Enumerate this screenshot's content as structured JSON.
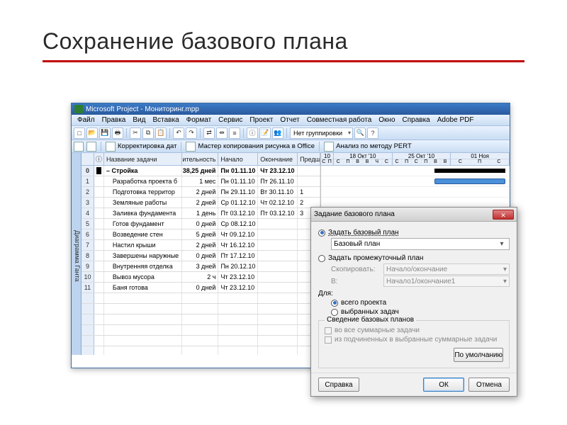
{
  "slide": {
    "title": "Сохранение базового плана"
  },
  "app": {
    "title": "Microsoft Project - Мониторинг.mpp",
    "menus": [
      "Файл",
      "Правка",
      "Вид",
      "Вставка",
      "Формат",
      "Сервис",
      "Проект",
      "Отчет",
      "Совместная работа",
      "Окно",
      "Справка",
      "Adobe PDF"
    ],
    "grouping": "Нет группировки",
    "toolbar2": {
      "item1": "Корректировка дат",
      "item2": "Мастер копирования рисунка в Office",
      "item3": "Анализ по методу PERT"
    },
    "sidestrip": "Диаграмма Ганта"
  },
  "columns": {
    "info": "",
    "indicator": "ⓘ",
    "name": "Название задачи",
    "duration": "Длительность",
    "start": "Начало",
    "finish": "Окончание",
    "pred": "Предшественники"
  },
  "rows": [
    {
      "n": "0",
      "ind": true,
      "name": "– Стройка",
      "dur": "38,25 дней",
      "start": "Пн 01.11.10",
      "finish": "Чт 23.12.10",
      "pred": "",
      "bold": true
    },
    {
      "n": "1",
      "name": "Разработка проекта б",
      "dur": "1 мес",
      "start": "Пн 01.11.10",
      "finish": "Пт 26.11.10",
      "pred": ""
    },
    {
      "n": "2",
      "name": "Подготовка территор",
      "dur": "2 дней",
      "start": "Пн 29.11.10",
      "finish": "Вт 30.11.10",
      "pred": "1"
    },
    {
      "n": "3",
      "name": "Земляные работы",
      "dur": "2 дней",
      "start": "Ср 01.12.10",
      "finish": "Чт 02.12.10",
      "pred": "2"
    },
    {
      "n": "4",
      "name": "Заливка фундамента",
      "dur": "1 день",
      "start": "Пт 03.12.10",
      "finish": "Пт 03.12.10",
      "pred": "3"
    },
    {
      "n": "5",
      "name": "Готов фундамент",
      "dur": "0 дней",
      "start": "Ср 08.12.10",
      "finish": "",
      "pred": ""
    },
    {
      "n": "6",
      "name": "Возведение стен",
      "dur": "5 дней",
      "start": "Чт 09.12.10",
      "finish": "",
      "pred": ""
    },
    {
      "n": "7",
      "name": "Настил крыши",
      "dur": "2 дней",
      "start": "Чт 16.12.10",
      "finish": "",
      "pred": ""
    },
    {
      "n": "8",
      "name": "Завершены наружные",
      "dur": "0 дней",
      "start": "Пт 17.12.10",
      "finish": "",
      "pred": ""
    },
    {
      "n": "9",
      "name": "Внутренняя отделка",
      "dur": "3 дней",
      "start": "Пн 20.12.10",
      "finish": "",
      "pred": ""
    },
    {
      "n": "10",
      "name": "Вывоз мусора",
      "dur": "2 ч",
      "start": "Чт 23.12.10",
      "finish": "",
      "pred": ""
    },
    {
      "n": "11",
      "name": "Баня готова",
      "dur": "0 дней",
      "start": "Чт 23.12.10",
      "finish": "",
      "pred": ""
    }
  ],
  "gantt": {
    "weeks": [
      "10",
      "18 Окт '10",
      "25 Окт '10",
      "01 Ноя"
    ],
    "days": [
      "С",
      "П",
      "С",
      "П",
      "В",
      "В",
      "Ч",
      "С"
    ]
  },
  "dialog": {
    "title": "Задание базового плана",
    "opt_baseline": "Задать базовый план",
    "baseline_value": "Базовый план",
    "opt_interim": "Задать промежуточный план",
    "copy_lbl": "Скопировать:",
    "copy_val": "Начало/окончание",
    "into_lbl": "В:",
    "into_val": "Начало1/окончание1",
    "for_lbl": "Для:",
    "for_all": "всего проекта",
    "for_sel": "выбранных задач",
    "group": "Сведение базовых планов",
    "chk1": "во все суммарные задачи",
    "chk2": "из подчиненных в выбранные суммарные задачи",
    "btn_default": "По умолчанию",
    "btn_help": "Справка",
    "btn_ok": "ОК",
    "btn_cancel": "Отмена"
  }
}
